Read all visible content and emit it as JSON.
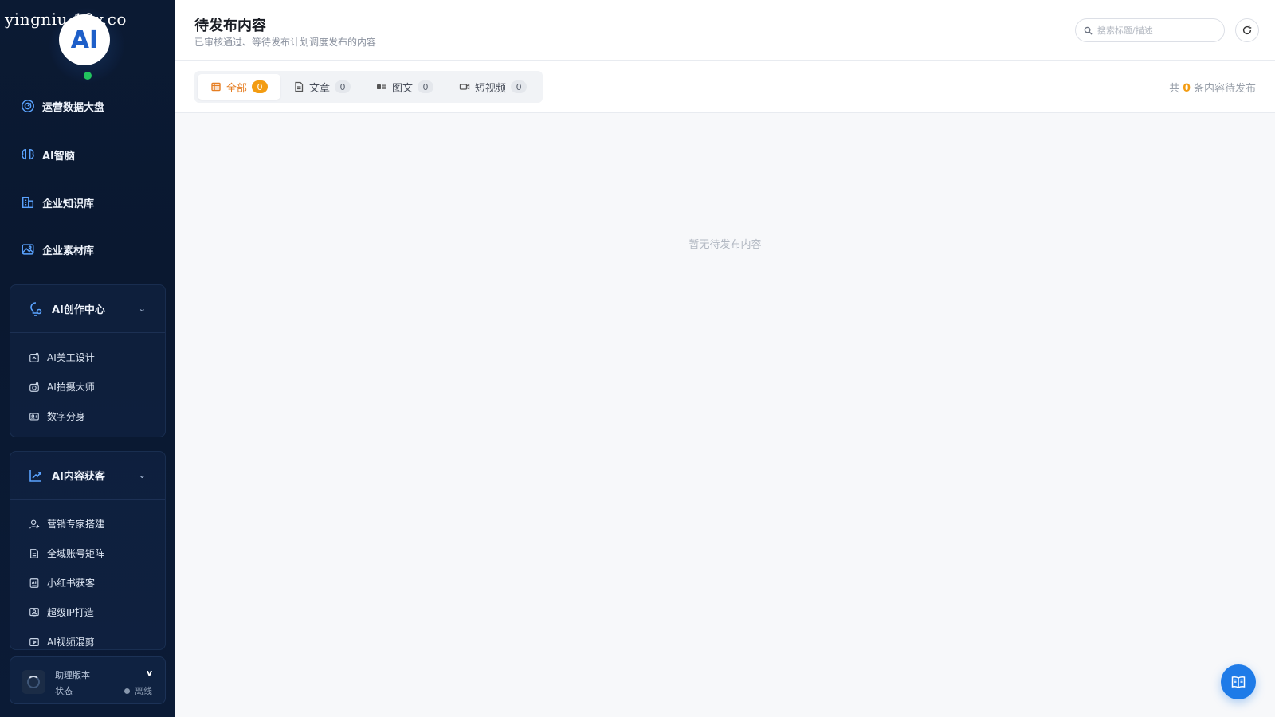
{
  "watermark": "yingniu.10v.co",
  "logo": {
    "text": "AI"
  },
  "sidebar": {
    "nav": [
      {
        "label": "运营数据大盘",
        "icon": "dashboard-icon"
      },
      {
        "label": "AI智脑",
        "icon": "brain-icon"
      },
      {
        "label": "企业知识库",
        "icon": "building-icon"
      },
      {
        "label": "企业素材库",
        "icon": "image-icon"
      }
    ],
    "group1": {
      "title": "AI创作中心",
      "icon": "lightbulb-gear-icon",
      "items": [
        {
          "label": "AI美工设计",
          "icon": "palette-icon"
        },
        {
          "label": "AI拍摄大师",
          "icon": "camera-icon"
        },
        {
          "label": "数字分身",
          "icon": "id-card-icon"
        }
      ]
    },
    "group2": {
      "title": "AI内容获客",
      "icon": "trend-chart-icon",
      "items": [
        {
          "label": "营销专家搭建",
          "icon": "user-add-icon"
        },
        {
          "label": "全域账号矩阵",
          "icon": "document-icon"
        },
        {
          "label": "小红书获客",
          "icon": "ai-doc-icon"
        },
        {
          "label": "超级IP打造",
          "icon": "monitor-user-icon"
        },
        {
          "label": "AI视频混剪",
          "icon": "video-edit-icon"
        }
      ]
    },
    "version": {
      "label": "助理版本",
      "value": "v",
      "status_label": "状态",
      "status_value": "离线"
    }
  },
  "header": {
    "title": "待发布内容",
    "subtitle": "已审核通过、等待发布计划调度发布的内容",
    "search_placeholder": "搜索标题/描述"
  },
  "tabs": [
    {
      "label": "全部",
      "count": "0",
      "icon": "list-icon",
      "active": true
    },
    {
      "label": "文章",
      "count": "0",
      "icon": "article-icon",
      "active": false
    },
    {
      "label": "图文",
      "count": "0",
      "icon": "image-text-icon",
      "active": false
    },
    {
      "label": "短视频",
      "count": "0",
      "icon": "video-icon",
      "active": false
    }
  ],
  "total": {
    "prefix": "共",
    "count": "0",
    "suffix": "条内容待发布"
  },
  "empty_text": "暂无待发布内容",
  "colors": {
    "accent": "#f39c12",
    "primary": "#1e7be8",
    "sidebar_bg": "#0b1a33",
    "online": "#22c55e"
  }
}
